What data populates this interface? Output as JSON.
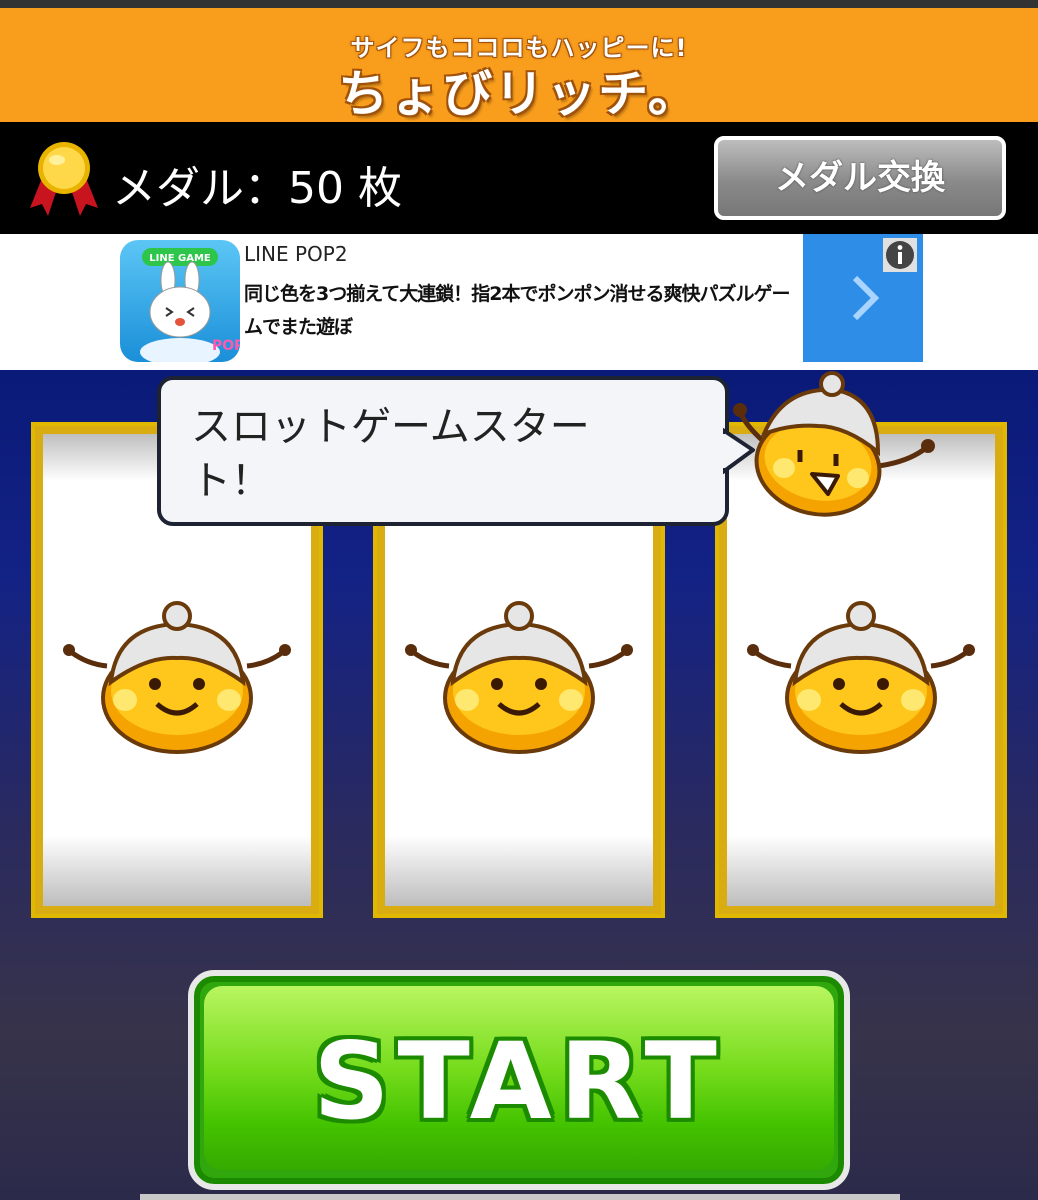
{
  "header": {
    "tagline": "サイフもココロもハッピーに!",
    "logo": "ちょびリッチ。",
    "brand_color": "#f99d1c"
  },
  "medal_bar": {
    "medal_text": "メダル：50 枚",
    "exchange_button": "メダル交換"
  },
  "ad": {
    "icon_badge": "LINE GAME",
    "title": "LINE POP2",
    "description": "同じ色を3つ揃えて大連鎖！指2本でポンポン消せる爽快パズルゲームでまた遊ぼ",
    "info_icon": "info-icon",
    "arrow_icon": "chevron-right-icon",
    "arrow_color": "#2e8de6"
  },
  "game": {
    "speech": "スロットゲームスタート！",
    "reels": [
      "mascot-smile",
      "mascot-smile",
      "mascot-smile"
    ],
    "start_button": "START",
    "start_color": "#44c300"
  }
}
